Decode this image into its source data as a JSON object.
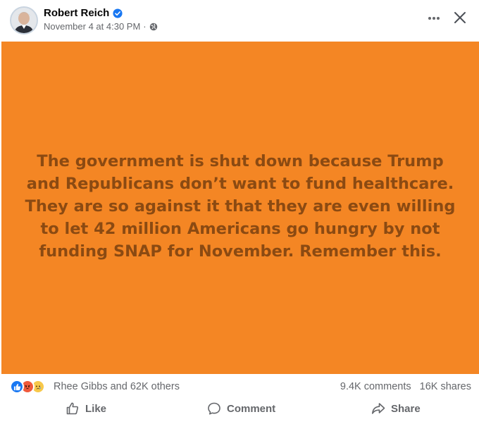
{
  "post": {
    "author": "Robert Reich",
    "timestamp": "November 4 at 4:30 PM",
    "separator": "·",
    "text": "The government is shut down because Trump and Republicans don’t want to fund healthcare. They are so against it that they are even willing to let 42 million Americans go hungry by not funding SNAP for November. Remember this.",
    "background_color": "#f48624",
    "text_color": "#8b4a12"
  },
  "header": {
    "icons": [
      "verified-badge-icon",
      "globe-icon",
      "more-options-icon",
      "close-icon"
    ]
  },
  "stats": {
    "reactions": [
      "like",
      "angry",
      "sad"
    ],
    "reactors": "Rhee Gibbs and 62K others",
    "comments": "9.4K comments",
    "shares": "16K shares"
  },
  "actions": {
    "like": "Like",
    "comment": "Comment",
    "share": "Share"
  },
  "colors": {
    "accent": "#1877f2",
    "muted": "#65676b"
  }
}
